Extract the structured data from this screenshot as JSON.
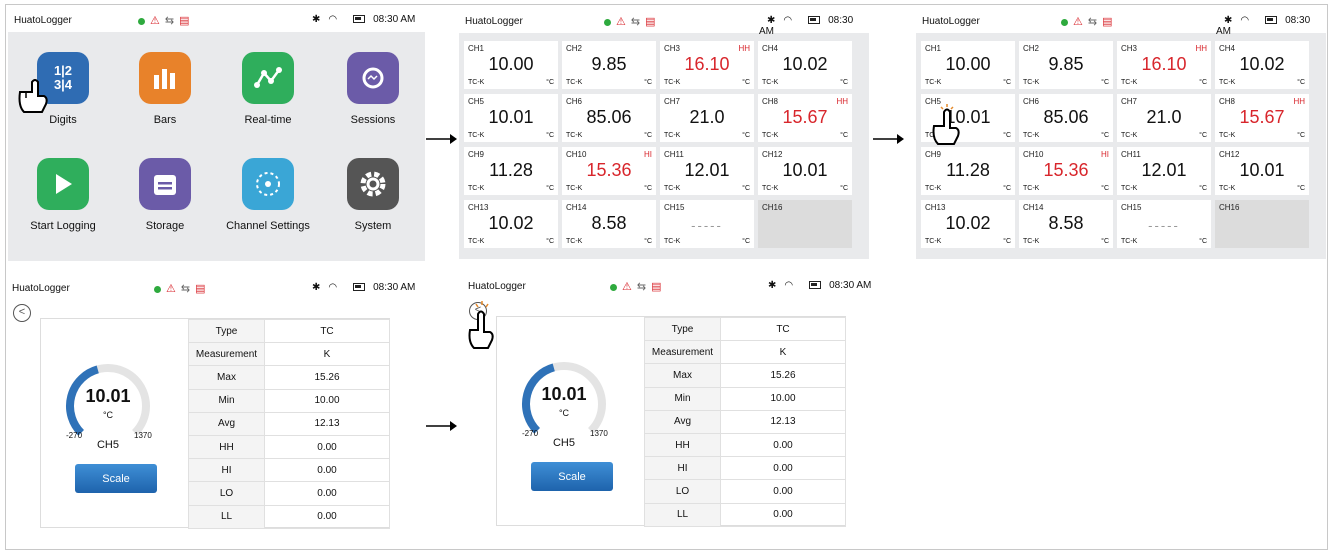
{
  "status": {
    "title": "HuatoLogger",
    "time": "08:30 AM",
    "icons": [
      "record-dot",
      "alarm-icon",
      "usb-icon",
      "sd-card-icon",
      "bluetooth-icon",
      "wifi-icon",
      "battery-icon"
    ]
  },
  "home": {
    "apps": [
      {
        "label": "Digits",
        "color": "#2f6cb3",
        "glyph": "1|2 3|4"
      },
      {
        "label": "Bars",
        "color": "#e8822a",
        "glyph": "bars"
      },
      {
        "label": "Real-time",
        "color": "#2fae5c",
        "glyph": "chart"
      },
      {
        "label": "Sessions",
        "color": "#6b5ba8",
        "glyph": "search"
      },
      {
        "label": "Start Logging",
        "color": "#2fae5c",
        "glyph": "play"
      },
      {
        "label": "Storage",
        "color": "#6b5ba8",
        "glyph": "storage"
      },
      {
        "label": "Channel Settings",
        "color": "#3aa6d6",
        "glyph": "network"
      },
      {
        "label": "System",
        "color": "#555555",
        "glyph": "gear"
      }
    ]
  },
  "channels": [
    {
      "ch": "CH1",
      "val": "10.00",
      "flag": "",
      "tc": "TC-K",
      "unit": "°C"
    },
    {
      "ch": "CH2",
      "val": "9.85",
      "flag": "",
      "tc": "TC-K",
      "unit": "°C"
    },
    {
      "ch": "CH3",
      "val": "16.10",
      "flag": "HH",
      "tc": "TC-K",
      "unit": "°C"
    },
    {
      "ch": "CH4",
      "val": "10.02",
      "flag": "",
      "tc": "TC-K",
      "unit": "°C"
    },
    {
      "ch": "CH5",
      "val": "10.01",
      "flag": "",
      "tc": "TC-K",
      "unit": "°C"
    },
    {
      "ch": "CH6",
      "val": "85.06",
      "flag": "",
      "tc": "TC-K",
      "unit": "°C"
    },
    {
      "ch": "CH7",
      "val": "21.0",
      "flag": "",
      "tc": "TC-K",
      "unit": "°C"
    },
    {
      "ch": "CH8",
      "val": "15.67",
      "flag": "HH",
      "tc": "TC-K",
      "unit": "°C"
    },
    {
      "ch": "CH9",
      "val": "11.28",
      "flag": "",
      "tc": "TC-K",
      "unit": "°C"
    },
    {
      "ch": "CH10",
      "val": "15.36",
      "flag": "HI",
      "tc": "TC-K",
      "unit": "°C"
    },
    {
      "ch": "CH11",
      "val": "12.01",
      "flag": "",
      "tc": "TC-K",
      "unit": "°C"
    },
    {
      "ch": "CH12",
      "val": "10.01",
      "flag": "",
      "tc": "TC-K",
      "unit": "°C"
    },
    {
      "ch": "CH13",
      "val": "10.02",
      "flag": "",
      "tc": "TC-K",
      "unit": "°C"
    },
    {
      "ch": "CH14",
      "val": "8.58",
      "flag": "",
      "tc": "TC-K",
      "unit": "°C"
    },
    {
      "ch": "CH15",
      "val": "-----",
      "flag": "",
      "tc": "TC-K",
      "unit": "°C"
    },
    {
      "ch": "CH16",
      "val": "",
      "flag": "",
      "tc": "",
      "unit": ""
    }
  ],
  "detail": {
    "value": "10.01",
    "unit": "°C",
    "min_label": "-270",
    "max_label": "1370",
    "channel": "CH5",
    "gauge_fraction": 0.17,
    "scale_label": "Scale",
    "back_glyph": "<",
    "rows": [
      {
        "k": "Type",
        "v": "TC"
      },
      {
        "k": "Measurement",
        "v": "K"
      },
      {
        "k": "Max",
        "v": "15.26"
      },
      {
        "k": "Min",
        "v": "10.00"
      },
      {
        "k": "Avg",
        "v": "12.13"
      },
      {
        "k": "HH",
        "v": "0.00"
      },
      {
        "k": "HI",
        "v": "0.00"
      },
      {
        "k": "LO",
        "v": "0.00"
      },
      {
        "k": "LL",
        "v": "0.00"
      }
    ]
  }
}
